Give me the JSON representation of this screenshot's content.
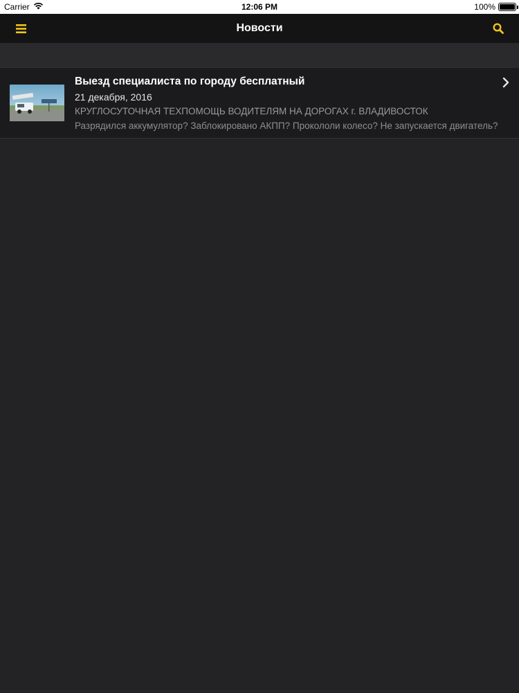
{
  "status_bar": {
    "carrier": "Carrier",
    "time": "12:06 PM",
    "battery": "100%"
  },
  "nav": {
    "title": "Новости",
    "accent_color": "#f2c41a"
  },
  "news": [
    {
      "title": "Выезд специалиста по городу бесплатный",
      "date": "21 декабря, 2016",
      "subtitle": "КРУГЛОСУТОЧНАЯ ТЕХПОМОЩЬ ВОДИТЕЛЯМ НА ДОРОГАХ г. ВЛАДИВОСТОК",
      "description": "Разрядился аккумулятор? Заблокировано АКПП? Прокололи колесо? Не запускается двигатель?"
    }
  ],
  "icons": [
    "wifi-icon",
    "battery-icon",
    "menu-icon",
    "search-icon",
    "chevron-right-icon"
  ]
}
